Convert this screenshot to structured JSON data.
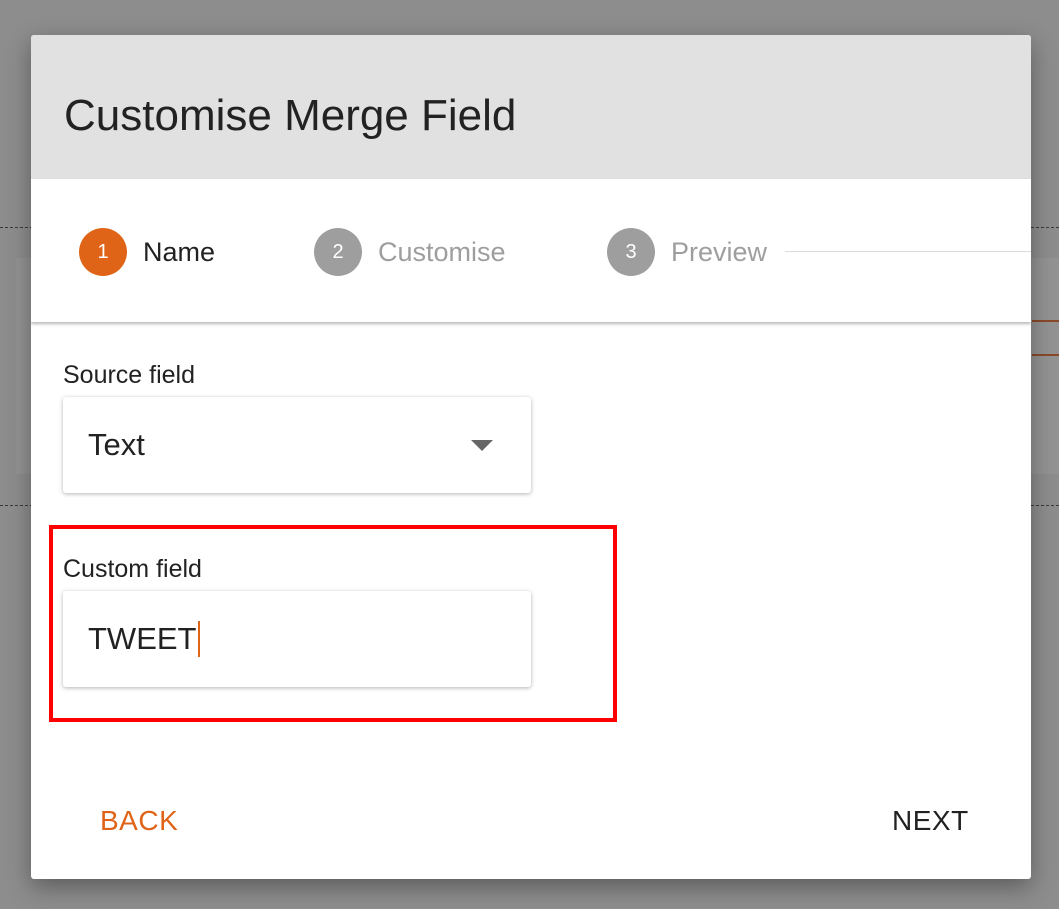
{
  "dialog": {
    "title": "Customise Merge Field"
  },
  "stepper": {
    "steps": [
      {
        "number": "1",
        "label": "Name",
        "state": "active"
      },
      {
        "number": "2",
        "label": "Customise",
        "state": "inactive"
      },
      {
        "number": "3",
        "label": "Preview",
        "state": "inactive"
      }
    ]
  },
  "form": {
    "source_field": {
      "label": "Source field",
      "selected_value": "Text"
    },
    "custom_field": {
      "label": "Custom field",
      "value": "TWEET"
    }
  },
  "actions": {
    "back_label": "BACK",
    "next_label": "NEXT"
  },
  "colors": {
    "accent": "#E06418",
    "inactive_step": "#9E9E9E",
    "highlight": "#FF0000",
    "header_bg": "#E1E1E1"
  }
}
